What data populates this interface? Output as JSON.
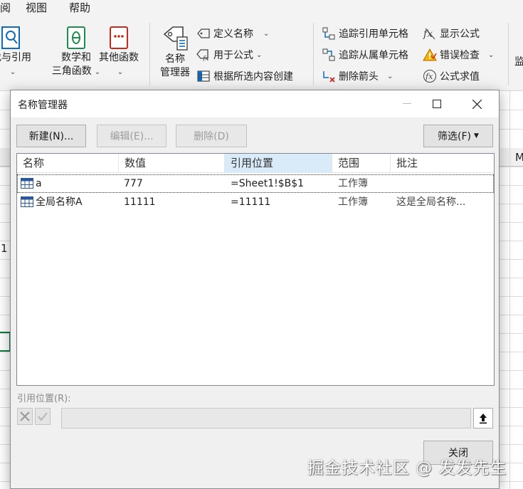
{
  "menubar": {
    "items": [
      "阅",
      "视图",
      "帮助"
    ]
  },
  "ribbon": {
    "lookup_label1": "找与引用",
    "math_label1": "数学和",
    "math_label2": "三角函数",
    "other_label": "其他函数",
    "name_mgr_label1": "名称",
    "name_mgr_label2": "管理器",
    "define_name": "定义名称",
    "use_in_formula": "用于公式",
    "create_from_selection": "根据所选内容创建",
    "trace_precedents": "追踪引用单元格",
    "trace_dependents": "追踪从属单元格",
    "remove_arrows": "删除箭头",
    "show_formulas": "显示公式",
    "error_checking": "错误检查",
    "evaluate_formula": "公式求值",
    "watch_partial": "监"
  },
  "sheet": {
    "col_label_partial": "M",
    "cell_partial": "1"
  },
  "dialog": {
    "title": "名称管理器",
    "buttons": {
      "new": "新建(N)...",
      "edit": "编辑(E)...",
      "delete": "删除(D)",
      "filter": "筛选(F)",
      "close": "关闭"
    },
    "columns": [
      "名称",
      "数值",
      "引用位置",
      "范围",
      "批注"
    ],
    "rows": [
      {
        "name": "a",
        "value": "777",
        "refers_to": "=Sheet1!$B$1",
        "scope": "工作簿",
        "comment": ""
      },
      {
        "name": "全局名称A",
        "value": "11111",
        "refers_to": "=11111",
        "scope": "工作簿",
        "comment": "这是全局名称..."
      }
    ],
    "refers_to_label": "引用位置(R):",
    "refers_to_value": ""
  },
  "watermark": "掘金技术社区 @ 发发先生",
  "colors": {
    "sorted_header": "#d9ebf9",
    "grid_line": "#dcdcdc",
    "dialog_bg": "#f0f0f0",
    "cancel_x": "#9a9a9a",
    "error_icon_red": "#d83b01"
  }
}
